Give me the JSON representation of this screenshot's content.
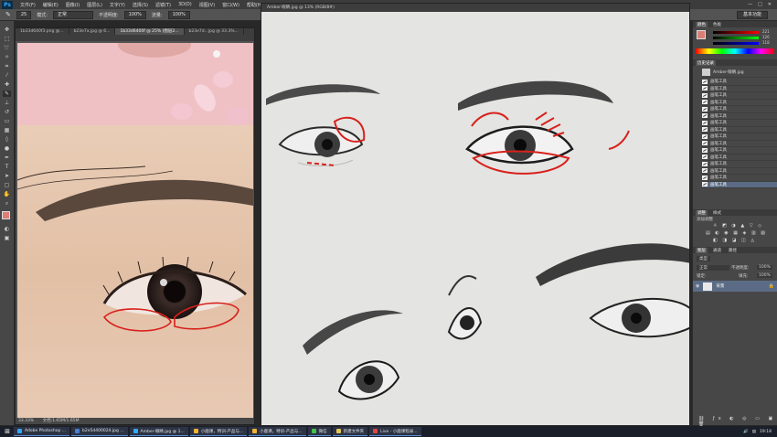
{
  "app": {
    "logo": "Ps",
    "menu": [
      "文件(F)",
      "编辑(E)",
      "图像(I)",
      "图层(L)",
      "文字(Y)",
      "选择(S)",
      "滤镜(T)",
      "3D(D)",
      "视图(V)",
      "窗口(W)",
      "帮助(H)"
    ],
    "window_buttons": [
      "—",
      "□",
      "✕"
    ]
  },
  "options": {
    "size": "25",
    "mode_label": "模式:",
    "mode_value": "正常",
    "opacity_label": "不透明度:",
    "opacity_value": "100%",
    "flow_label": "流量:",
    "flow_value": "100%",
    "workspace": "基本功能"
  },
  "tools": [
    "move-icon",
    "marquee-icon",
    "lasso-icon",
    "quick-select-icon",
    "crop-icon",
    "eyedropper-icon",
    "healing-icon",
    "brush-icon",
    "clone-stamp-icon",
    "history-brush-icon",
    "eraser-icon",
    "gradient-icon",
    "blur-icon",
    "dodge-icon",
    "pen-icon",
    "type-icon",
    "path-select-icon",
    "shape-icon",
    "hand-icon",
    "zoom-icon"
  ],
  "doc1": {
    "tabs": [
      "1b33d640f3.png @...",
      "b23e7a.jpg @ 6...",
      "1b33d6400f @ 25% (图层2...",
      "b23e7d...jpg @ 33.3%..."
    ],
    "status_zoom": "33.33%",
    "status_doc": "文档:1.65M/1.65M"
  },
  "doc2": {
    "title": "Amber-眼睛.jpg @ 13% (RGB/8#)"
  },
  "panels": {
    "color_tabs": [
      "颜色",
      "色板"
    ],
    "color_values": [
      "221",
      "126",
      "118"
    ],
    "layers_tabs": [
      "历史记录"
    ],
    "history_file": "Amber-眼睛.jpg",
    "history_items": [
      "画笔工具",
      "画笔工具",
      "画笔工具",
      "画笔工具",
      "画笔工具",
      "画笔工具",
      "画笔工具",
      "画笔工具",
      "画笔工具",
      "画笔工具",
      "画笔工具",
      "画笔工具",
      "画笔工具",
      "画笔工具",
      "画笔工具",
      "画笔工具"
    ],
    "adjust_tabs": [
      "调整",
      "样式"
    ],
    "adjust_label": "添加调整",
    "layer_tabs": [
      "图层",
      "通道",
      "路径"
    ],
    "layer_kind": "类型",
    "layer_mode": "正常",
    "layer_opacity_label": "不透明度:",
    "layer_opacity": "100%",
    "layer_fill_label": "填充:",
    "layer_fill": "100%",
    "layer_lock_label": "锁定:",
    "layer_name": "背景"
  },
  "taskbar": {
    "items": [
      {
        "label": "Adobe Photoshop ...",
        "color": "#31a8ff"
      },
      {
        "label": "b2e5d400024.jpg ...",
        "color": "#4a7fd0"
      },
      {
        "label": "Amber-眼睛.jpg @ 1...",
        "color": "#31a8ff"
      },
      {
        "label": "小鹿课，特训-产品与...",
        "color": "#f2b233"
      },
      {
        "label": "小鹿课，特训-产品与...",
        "color": "#f2b233"
      },
      {
        "label": "微信",
        "color": "#44c04b"
      },
      {
        "label": "新建文件夹",
        "color": "#e8c45a"
      },
      {
        "label": "Live - 小鹿课程录...",
        "color": "#d44"
      }
    ],
    "time": "19:18"
  }
}
